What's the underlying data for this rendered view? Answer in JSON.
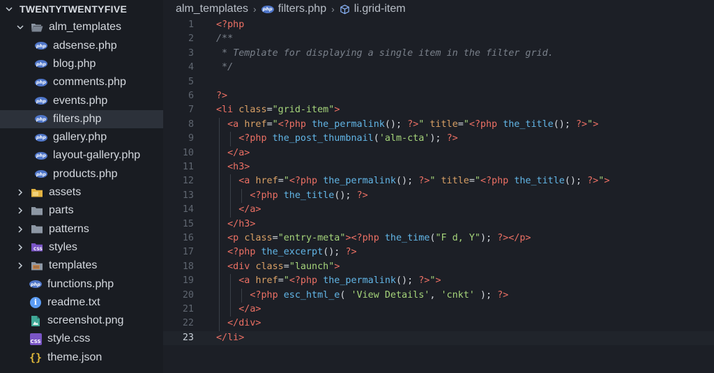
{
  "explorer": {
    "root": "TWENTYTWENTYFIVE",
    "items": [
      {
        "label": "alm_templates",
        "icon": "folder-open-icon"
      },
      {
        "label": "adsense.php",
        "icon": "php-icon"
      },
      {
        "label": "blog.php",
        "icon": "php-icon"
      },
      {
        "label": "comments.php",
        "icon": "php-icon"
      },
      {
        "label": "events.php",
        "icon": "php-icon"
      },
      {
        "label": "filters.php",
        "icon": "php-icon",
        "selected": true
      },
      {
        "label": "gallery.php",
        "icon": "php-icon"
      },
      {
        "label": "layout-gallery.php",
        "icon": "php-icon"
      },
      {
        "label": "products.php",
        "icon": "php-icon"
      },
      {
        "label": "assets",
        "icon": "folder-yellow-icon"
      },
      {
        "label": "parts",
        "icon": "folder-icon"
      },
      {
        "label": "patterns",
        "icon": "folder-icon"
      },
      {
        "label": "styles",
        "icon": "folder-css-icon"
      },
      {
        "label": "templates",
        "icon": "folder-templates-icon"
      },
      {
        "label": "functions.php",
        "icon": "php-icon"
      },
      {
        "label": "readme.txt",
        "icon": "info-icon"
      },
      {
        "label": "screenshot.png",
        "icon": "image-icon"
      },
      {
        "label": "style.css",
        "icon": "css-icon"
      },
      {
        "label": "theme.json",
        "icon": "json-icon"
      }
    ],
    "php_badge_text": "php",
    "css_badge_text": "CSS"
  },
  "breadcrumb": {
    "folder": "alm_templates",
    "file": "filters.php",
    "symbol": "li.grid-item"
  },
  "editor": {
    "current_line": 23,
    "lines": [
      [
        [
          "tag",
          "<?php"
        ]
      ],
      [
        [
          "cm",
          "/**"
        ]
      ],
      [
        [
          "cm",
          " * Template for displaying a single item in the filter grid."
        ]
      ],
      [
        [
          "cm",
          " */"
        ]
      ],
      [],
      [
        [
          "tag",
          "?>"
        ]
      ],
      [
        [
          "tag",
          "<li "
        ],
        [
          "attr",
          "class"
        ],
        [
          "txt",
          "="
        ],
        [
          "str",
          "\"grid-item\""
        ],
        [
          "tag",
          ">"
        ]
      ],
      [
        [
          "ws",
          "  "
        ],
        [
          "tag",
          "<a "
        ],
        [
          "attr",
          "href"
        ],
        [
          "txt",
          "="
        ],
        [
          "str",
          "\""
        ],
        [
          "kw",
          "<?php "
        ],
        [
          "fn",
          "the_permalink"
        ],
        [
          "txt",
          "(); "
        ],
        [
          "kw",
          "?>"
        ],
        [
          "str",
          "\""
        ],
        [
          "attr",
          " title"
        ],
        [
          "txt",
          "="
        ],
        [
          "str",
          "\""
        ],
        [
          "kw",
          "<?php "
        ],
        [
          "fn",
          "the_title"
        ],
        [
          "txt",
          "(); "
        ],
        [
          "kw",
          "?>"
        ],
        [
          "str",
          "\""
        ],
        [
          "tag",
          ">"
        ]
      ],
      [
        [
          "ws",
          "    "
        ],
        [
          "kw",
          "<?php "
        ],
        [
          "fn",
          "the_post_thumbnail"
        ],
        [
          "txt",
          "("
        ],
        [
          "str",
          "'alm-cta'"
        ],
        [
          "txt",
          "); "
        ],
        [
          "kw",
          "?>"
        ]
      ],
      [
        [
          "ws",
          "  "
        ],
        [
          "tag",
          "</a>"
        ]
      ],
      [
        [
          "ws",
          "  "
        ],
        [
          "tag",
          "<h3>"
        ]
      ],
      [
        [
          "ws",
          "    "
        ],
        [
          "tag",
          "<a "
        ],
        [
          "attr",
          "href"
        ],
        [
          "txt",
          "="
        ],
        [
          "str",
          "\""
        ],
        [
          "kw",
          "<?php "
        ],
        [
          "fn",
          "the_permalink"
        ],
        [
          "txt",
          "(); "
        ],
        [
          "kw",
          "?>"
        ],
        [
          "str",
          "\""
        ],
        [
          "attr",
          " title"
        ],
        [
          "txt",
          "="
        ],
        [
          "str",
          "\""
        ],
        [
          "kw",
          "<?php "
        ],
        [
          "fn",
          "the_title"
        ],
        [
          "txt",
          "(); "
        ],
        [
          "kw",
          "?>"
        ],
        [
          "str",
          "\""
        ],
        [
          "tag",
          ">"
        ]
      ],
      [
        [
          "ws",
          "      "
        ],
        [
          "kw",
          "<?php "
        ],
        [
          "fn",
          "the_title"
        ],
        [
          "txt",
          "(); "
        ],
        [
          "kw",
          "?>"
        ]
      ],
      [
        [
          "ws",
          "    "
        ],
        [
          "tag",
          "</a>"
        ]
      ],
      [
        [
          "ws",
          "  "
        ],
        [
          "tag",
          "</h3>"
        ]
      ],
      [
        [
          "ws",
          "  "
        ],
        [
          "tag",
          "<p "
        ],
        [
          "attr",
          "class"
        ],
        [
          "txt",
          "="
        ],
        [
          "str",
          "\"entry-meta\""
        ],
        [
          "tag",
          ">"
        ],
        [
          "kw",
          "<?php "
        ],
        [
          "fn",
          "the_time"
        ],
        [
          "txt",
          "("
        ],
        [
          "str",
          "\"F d, Y\""
        ],
        [
          "txt",
          "); "
        ],
        [
          "kw",
          "?>"
        ],
        [
          "tag",
          "</p>"
        ]
      ],
      [
        [
          "ws",
          "  "
        ],
        [
          "kw",
          "<?php "
        ],
        [
          "fn",
          "the_excerpt"
        ],
        [
          "txt",
          "(); "
        ],
        [
          "kw",
          "?>"
        ]
      ],
      [
        [
          "ws",
          "  "
        ],
        [
          "tag",
          "<div "
        ],
        [
          "attr",
          "class"
        ],
        [
          "txt",
          "="
        ],
        [
          "str",
          "\"launch\""
        ],
        [
          "tag",
          ">"
        ]
      ],
      [
        [
          "ws",
          "    "
        ],
        [
          "tag",
          "<a "
        ],
        [
          "attr",
          "href"
        ],
        [
          "txt",
          "="
        ],
        [
          "str",
          "\""
        ],
        [
          "kw",
          "<?php "
        ],
        [
          "fn",
          "the_permalink"
        ],
        [
          "txt",
          "(); "
        ],
        [
          "kw",
          "?>"
        ],
        [
          "str",
          "\""
        ],
        [
          "tag",
          ">"
        ]
      ],
      [
        [
          "ws",
          "      "
        ],
        [
          "kw",
          "<?php "
        ],
        [
          "fn",
          "esc_html_e"
        ],
        [
          "txt",
          "( "
        ],
        [
          "str",
          "'View Details'"
        ],
        [
          "txt",
          ", "
        ],
        [
          "str",
          "'cnkt'"
        ],
        [
          "txt",
          " ); "
        ],
        [
          "kw",
          "?>"
        ]
      ],
      [
        [
          "ws",
          "    "
        ],
        [
          "tag",
          "</a>"
        ]
      ],
      [
        [
          "ws",
          "  "
        ],
        [
          "tag",
          "</div>"
        ]
      ],
      [
        [
          "tag",
          "</li>"
        ]
      ]
    ]
  },
  "colors": {
    "tag": "#ec7064",
    "attr": "#d9a065",
    "string": "#a5d47a",
    "function": "#62b6e7",
    "comment": "#7a818b",
    "selection": "#2c313a"
  }
}
